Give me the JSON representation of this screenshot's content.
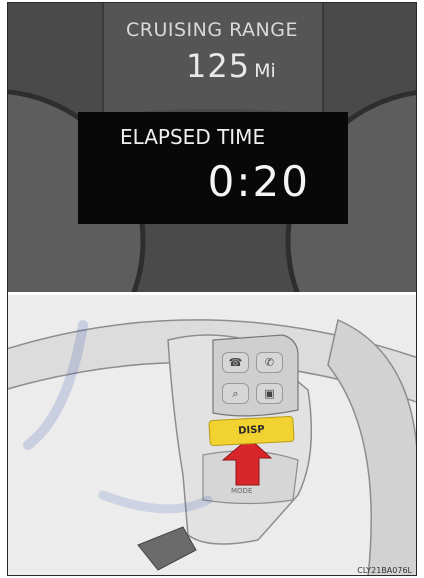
{
  "display": {
    "cruising_range_label": "CRUISING RANGE",
    "cruising_range_value": "125",
    "cruising_range_unit": "Mi",
    "elapsed_time_label": "ELAPSED TIME",
    "elapsed_time_value": "0:20"
  },
  "steering_switch": {
    "disp_label": "DISP",
    "mode_label": "MODE",
    "buttons": [
      "phone-pickup-icon",
      "talk-icon",
      "phone-hangup-icon",
      "phone-book-icon"
    ],
    "disp_color": "#f1d231",
    "arrow_color": "#d8262b"
  },
  "caption": "CLY21BA076L"
}
